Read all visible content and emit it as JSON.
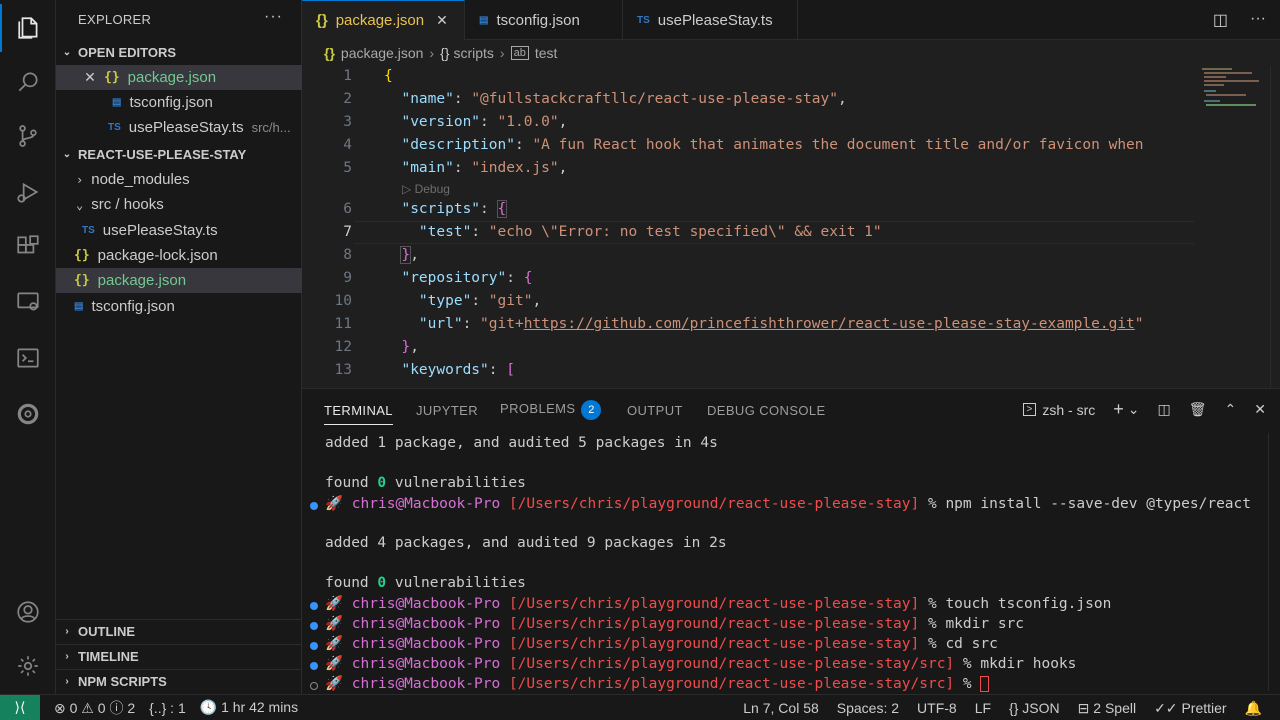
{
  "sidebar": {
    "title": "EXPLORER",
    "open_editors_label": "OPEN EDITORS",
    "open_editors": [
      {
        "name": "package.json",
        "type": "json"
      },
      {
        "name": "tsconfig.json",
        "type": "ts"
      },
      {
        "name": "usePleaseStay.ts",
        "type": "ts",
        "path": "src/h..."
      }
    ],
    "project_label": "REACT-USE-PLEASE-STAY",
    "tree": [
      {
        "name": "node_modules"
      },
      {
        "name": "src / hooks"
      },
      {
        "name": "usePleaseStay.ts"
      },
      {
        "name": "package-lock.json"
      },
      {
        "name": "package.json"
      },
      {
        "name": "tsconfig.json"
      }
    ],
    "outline_label": "OUTLINE",
    "timeline_label": "TIMELINE",
    "npm_label": "NPM SCRIPTS"
  },
  "tabs": [
    {
      "label": "package.json",
      "active": true
    },
    {
      "label": "tsconfig.json"
    },
    {
      "label": "usePleaseStay.ts"
    }
  ],
  "breadcrumb": [
    "package.json",
    "scripts",
    "test"
  ],
  "editor": {
    "line_numbers": [
      "1",
      "2",
      "3",
      "4",
      "5",
      "6",
      "7",
      "8",
      "9",
      "10",
      "11",
      "12",
      "13"
    ],
    "codelens": "Debug",
    "lines": {
      "l2_key": "\"name\"",
      "l2_val": "\"@fullstackcraftllc/react-use-please-stay\"",
      "l3_key": "\"version\"",
      "l3_val": "\"1.0.0\"",
      "l4_key": "\"description\"",
      "l4_val": "\"A fun React hook that animates the document title and/or favicon when",
      "l5_key": "\"main\"",
      "l5_val": "\"index.js\"",
      "l6_key": "\"scripts\"",
      "l7_key": "\"test\"",
      "l7_val": "\"echo \\\"Error: no test specified\\\" && exit 1\"",
      "l9_key": "\"repository\"",
      "l10_key": "\"type\"",
      "l10_val": "\"git\"",
      "l11_key": "\"url\"",
      "l11_val_prefix": "\"git+",
      "l11_val_url": "https://github.com/princefishthrower/react-use-please-stay-example.git",
      "l11_val_end": "\"",
      "l13_key": "\"keywords\""
    }
  },
  "panel": {
    "tabs": [
      "TERMINAL",
      "JUPYTER",
      "PROBLEMS",
      "OUTPUT",
      "DEBUG CONSOLE"
    ],
    "problems_count": "2",
    "shell_label": "zsh - src",
    "terminal": {
      "t1": "added 1 package, and audited 5 packages in 4s",
      "t2_pre": "found ",
      "t2_zero": "0",
      "t2_post": " vulnerabilities",
      "prompt_user": "chris@Macbook-Pro",
      "prompt_path": "[/Users/chris/playground/react-use-please-stay]",
      "prompt_path_src": "[/Users/chris/playground/react-use-please-stay/src]",
      "cmd1": "% npm install --save-dev @types/react",
      "t3": "added 4 packages, and audited 9 packages in 2s",
      "cmd2": "% touch tsconfig.json",
      "cmd3": "% mkdir src",
      "cmd4": "% cd src",
      "cmd5": "% mkdir hooks",
      "cmd6": "%"
    }
  },
  "status": {
    "errors": "0",
    "warnings": "0",
    "info": "2",
    "braces": "{..} : 1",
    "time": "1 hr 42 mins",
    "position": "Ln 7, Col 58",
    "spaces": "Spaces: 2",
    "encoding": "UTF-8",
    "eol": "LF",
    "language": "JSON",
    "spell": "2 Spell",
    "prettier": "Prettier"
  }
}
